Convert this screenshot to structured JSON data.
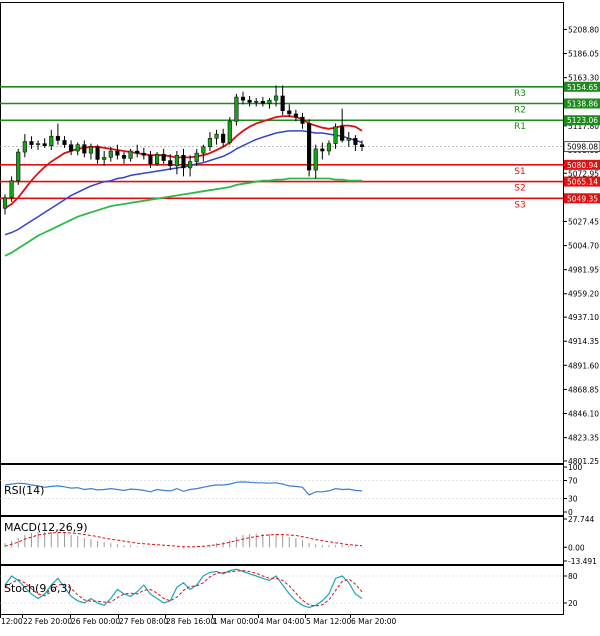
{
  "chart_data": {
    "type": "candlestick",
    "main": {
      "y_ticks": [
        5208.8,
        5186.05,
        5163.3,
        5140.55,
        5117.8,
        5095.05,
        5072.95,
        5050.2,
        5027.45,
        5004.7,
        4981.95,
        4959.2,
        4937.1,
        4914.35,
        4891.6,
        4868.85,
        4846.1,
        4823.35,
        4801.25
      ],
      "y_tick_labels": [
        "5208.80",
        "5186.05",
        "5163.30",
        "5140.55",
        "5117.80",
        "5095.05",
        "5072.95",
        "5050.20",
        "5027.45",
        "5004.70",
        "4981.95",
        "4959.20",
        "4937.10",
        "4914.35",
        "4891.60",
        "4868.85",
        "4846.10",
        "4823.35",
        "4801.25"
      ],
      "ylim": [
        4801.25,
        5230.0
      ],
      "current_price": {
        "value": 5098.08,
        "label": "5098.08"
      },
      "levels": [
        {
          "name": "R3",
          "value": 5154.65,
          "label": "5154.65",
          "color": "#1e8a1e"
        },
        {
          "name": "R2",
          "value": 5138.86,
          "label": "5138.86",
          "color": "#1e8a1e"
        },
        {
          "name": "R1",
          "value": 5123.06,
          "label": "5123.06",
          "color": "#1e8a1e"
        },
        {
          "name": "S1",
          "value": 5080.94,
          "label": "5080.94",
          "color": "#e01010"
        },
        {
          "name": "S2",
          "value": 5065.14,
          "label": "5065.14",
          "color": "#e01010"
        },
        {
          "name": "S3",
          "value": 5049.35,
          "label": "5049.35",
          "color": "#e01010"
        }
      ],
      "candles": [
        [
          5040,
          5053,
          5034,
          5050
        ],
        [
          5050,
          5070,
          5046,
          5066
        ],
        [
          5066,
          5096,
          5062,
          5093
        ],
        [
          5093,
          5110,
          5088,
          5103
        ],
        [
          5103,
          5108,
          5096,
          5100
        ],
        [
          5100,
          5104,
          5095,
          5101
        ],
        [
          5101,
          5106,
          5097,
          5099
        ],
        [
          5099,
          5114,
          5095,
          5108
        ],
        [
          5108,
          5120,
          5100,
          5104
        ],
        [
          5104,
          5108,
          5097,
          5100
        ],
        [
          5100,
          5104,
          5090,
          5094
        ],
        [
          5094,
          5102,
          5090,
          5100
        ],
        [
          5100,
          5104,
          5088,
          5092
        ],
        [
          5092,
          5101,
          5086,
          5098
        ],
        [
          5098,
          5100,
          5082,
          5086
        ],
        [
          5086,
          5094,
          5080,
          5088
        ],
        [
          5088,
          5098,
          5084,
          5094
        ],
        [
          5094,
          5100,
          5086,
          5090
        ],
        [
          5090,
          5093,
          5082,
          5087
        ],
        [
          5087,
          5096,
          5084,
          5094
        ],
        [
          5094,
          5100,
          5088,
          5092
        ],
        [
          5092,
          5097,
          5086,
          5090
        ],
        [
          5090,
          5094,
          5078,
          5082
        ],
        [
          5082,
          5093,
          5080,
          5091
        ],
        [
          5091,
          5096,
          5082,
          5085
        ],
        [
          5085,
          5091,
          5076,
          5080
        ],
        [
          5080,
          5094,
          5072,
          5090
        ],
        [
          5090,
          5096,
          5070,
          5078
        ],
        [
          5078,
          5090,
          5070,
          5084
        ],
        [
          5084,
          5096,
          5080,
          5092
        ],
        [
          5092,
          5100,
          5084,
          5098
        ],
        [
          5098,
          5112,
          5094,
          5106
        ],
        [
          5106,
          5114,
          5100,
          5110
        ],
        [
          5110,
          5115,
          5098,
          5102
        ],
        [
          5102,
          5126,
          5100,
          5122
        ],
        [
          5122,
          5148,
          5118,
          5145
        ],
        [
          5145,
          5150,
          5138,
          5142
        ],
        [
          5142,
          5146,
          5136,
          5140
        ],
        [
          5140,
          5144,
          5136,
          5141
        ],
        [
          5141,
          5145,
          5136,
          5139
        ],
        [
          5139,
          5144,
          5134,
          5142
        ],
        [
          5142,
          5156,
          5136,
          5146
        ],
        [
          5146,
          5156,
          5128,
          5132
        ],
        [
          5132,
          5138,
          5126,
          5129
        ],
        [
          5129,
          5133,
          5122,
          5126
        ],
        [
          5126,
          5130,
          5115,
          5120
        ],
        [
          5120,
          5124,
          5070,
          5076
        ],
        [
          5076,
          5100,
          5068,
          5096
        ],
        [
          5096,
          5102,
          5086,
          5094
        ],
        [
          5094,
          5104,
          5090,
          5101
        ],
        [
          5101,
          5120,
          5096,
          5117
        ],
        [
          5117,
          5134,
          5102,
          5104
        ],
        [
          5104,
          5112,
          5098,
          5106
        ],
        [
          5106,
          5109,
          5094,
          5100
        ],
        [
          5100,
          5104,
          5094,
          5098
        ]
      ],
      "ma_red": [
        5040,
        5044,
        5050,
        5058,
        5066,
        5073,
        5079,
        5084,
        5088,
        5092,
        5094,
        5096,
        5097,
        5098,
        5098,
        5097,
        5096,
        5095,
        5094,
        5093,
        5092,
        5091,
        5090,
        5090,
        5090,
        5089,
        5088,
        5088,
        5088,
        5089,
        5090,
        5092,
        5095,
        5098,
        5102,
        5108,
        5113,
        5117,
        5120,
        5122,
        5124,
        5126,
        5127,
        5127,
        5126,
        5124,
        5120,
        5118,
        5116,
        5115,
        5116,
        5118,
        5118,
        5117,
        5113
      ],
      "ma_blue": [
        5015,
        5017,
        5020,
        5024,
        5028,
        5032,
        5036,
        5040,
        5044,
        5048,
        5052,
        5055,
        5058,
        5061,
        5063,
        5065,
        5066,
        5068,
        5069,
        5071,
        5072,
        5073,
        5074,
        5075,
        5076,
        5077,
        5078,
        5079,
        5080,
        5082,
        5083,
        5085,
        5087,
        5089,
        5092,
        5096,
        5099,
        5102,
        5105,
        5107,
        5109,
        5111,
        5112,
        5113,
        5113,
        5113,
        5112,
        5111,
        5111,
        5110,
        5109,
        5108,
        5106,
        5104,
        5102
      ],
      "ma_green": [
        4995,
        4998,
        5002,
        5006,
        5010,
        5014,
        5017,
        5020,
        5023,
        5026,
        5029,
        5032,
        5034,
        5036,
        5038,
        5040,
        5042,
        5043,
        5044,
        5045,
        5046,
        5047,
        5048,
        5049,
        5050,
        5051,
        5052,
        5053,
        5054,
        5055,
        5056,
        5057,
        5058,
        5059,
        5060,
        5062,
        5063,
        5064,
        5065,
        5066,
        5066,
        5067,
        5067,
        5068,
        5068,
        5068,
        5068,
        5068,
        5068,
        5068,
        5067,
        5067,
        5066,
        5066,
        5066
      ]
    },
    "rsi": {
      "label": "RSI(14)",
      "y_ticks": [
        100,
        70,
        30,
        0
      ],
      "y_tick_labels": [
        "100",
        "70",
        "30",
        "0"
      ],
      "ylim": [
        0,
        100
      ],
      "values": [
        60,
        62,
        64,
        63,
        60,
        58,
        55,
        57,
        58,
        56,
        53,
        54,
        50,
        52,
        49,
        50,
        52,
        50,
        48,
        51,
        50,
        48,
        45,
        50,
        48,
        47,
        52,
        46,
        50,
        52,
        55,
        58,
        60,
        60,
        62,
        66,
        67,
        66,
        65,
        65,
        64,
        65,
        62,
        58,
        57,
        55,
        38,
        45,
        45,
        47,
        52,
        50,
        51,
        48,
        47
      ]
    },
    "macd": {
      "label": "MACD(12,26,9)",
      "y_ticks": [
        27.744,
        0.0,
        -13.491
      ],
      "y_tick_labels": [
        "27.744",
        "0.00",
        "-13.491"
      ],
      "ylim": [
        -13.491,
        27.744
      ],
      "histogram": [
        4,
        6,
        9,
        12,
        14,
        15,
        15,
        15,
        15,
        14,
        12,
        11,
        9,
        8,
        6,
        5,
        4,
        3,
        2,
        2,
        1,
        1,
        0.5,
        0.5,
        0.5,
        0,
        -0.5,
        -1,
        -0.5,
        0,
        1,
        2,
        4,
        5,
        7,
        10,
        12,
        13,
        13,
        13,
        13,
        13,
        12,
        10,
        9,
        7,
        4,
        3,
        2,
        2,
        2,
        2,
        1,
        1,
        0.5
      ],
      "signal": [
        1,
        3,
        5,
        8,
        10,
        12,
        13,
        14,
        14.5,
        14.5,
        14,
        13.5,
        12.5,
        11.5,
        10.5,
        9,
        8,
        7,
        6,
        5,
        4,
        3.5,
        3,
        2.5,
        2,
        1.5,
        1,
        0.5,
        0.5,
        0.5,
        1,
        1.5,
        2.5,
        3.5,
        5,
        6.5,
        8,
        9.5,
        10.5,
        11.5,
        12,
        12.5,
        12.5,
        12,
        11.5,
        10.5,
        9,
        7.5,
        6.5,
        5.5,
        4.5,
        3.5,
        2.5,
        2,
        1.5
      ]
    },
    "stoch": {
      "label": "Stoch(9,6,3)",
      "y_ticks": [
        80,
        20
      ],
      "y_tick_labels": [
        "80",
        "20"
      ],
      "ylim": [
        0,
        100
      ],
      "k": [
        60,
        80,
        70,
        55,
        40,
        30,
        40,
        60,
        75,
        55,
        35,
        25,
        20,
        30,
        20,
        15,
        30,
        50,
        40,
        35,
        45,
        60,
        40,
        30,
        20,
        25,
        55,
        65,
        50,
        60,
        80,
        88,
        90,
        85,
        92,
        95,
        90,
        85,
        80,
        75,
        70,
        80,
        60,
        40,
        25,
        15,
        10,
        15,
        25,
        40,
        75,
        80,
        65,
        40,
        30
      ],
      "d": [
        55,
        65,
        72,
        65,
        52,
        40,
        36,
        45,
        60,
        62,
        52,
        38,
        27,
        24,
        24,
        22,
        22,
        32,
        40,
        42,
        40,
        48,
        50,
        42,
        30,
        25,
        33,
        48,
        57,
        58,
        65,
        78,
        86,
        88,
        89,
        91,
        92,
        90,
        86,
        80,
        75,
        75,
        70,
        58,
        42,
        26,
        16,
        13,
        16,
        27,
        48,
        68,
        73,
        62,
        45
      ]
    },
    "x_tick_labels": [
      "12:00",
      "22 Feb 20:00",
      "26 Feb 00:00",
      "27 Feb 08:00",
      "28 Feb 16:00",
      "1 Mar 00:00",
      "4 Mar 04:00",
      "5 Mar 12:00",
      "6 Mar 20:00"
    ]
  }
}
